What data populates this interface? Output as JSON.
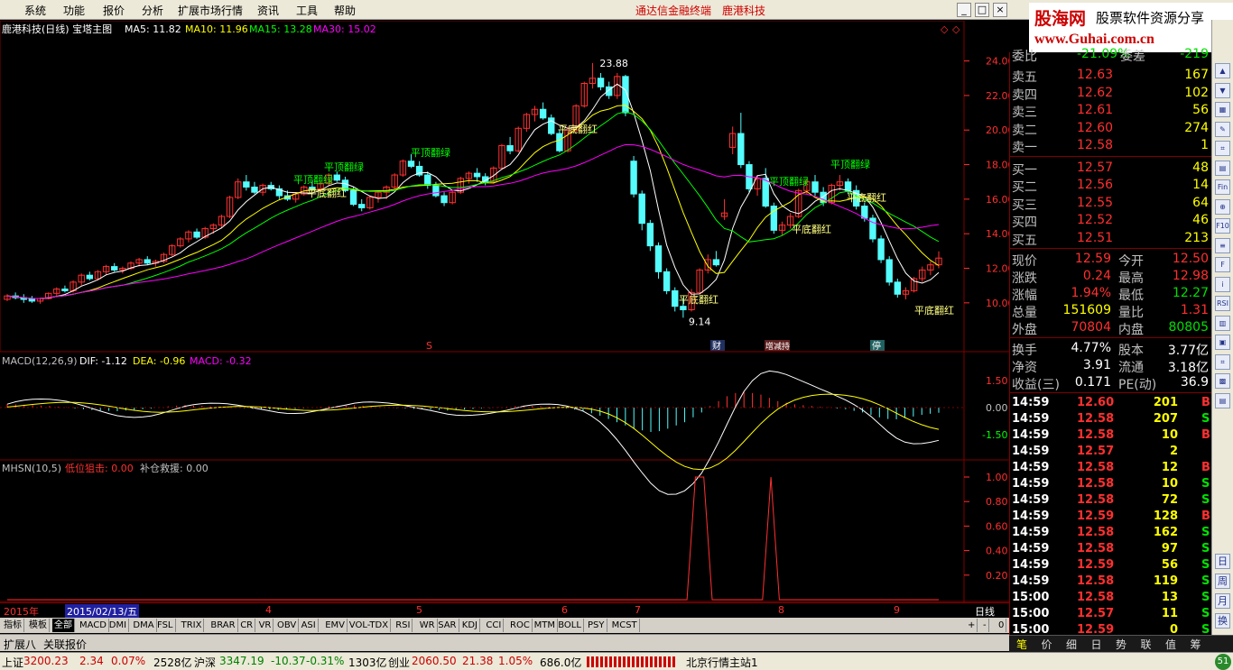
{
  "menu": {
    "items": [
      "系统",
      "功能",
      "报价",
      "分析",
      "扩展市场行情",
      "资讯",
      "工具",
      "帮助"
    ],
    "window_title": "通达信金融终端",
    "stock_title": "鹿港科技",
    "win_buttons": [
      "_",
      "□",
      "×"
    ]
  },
  "logo": {
    "cn": "股海网",
    "sub": "股票软件资源分享",
    "url": "www.Guhai.com.cn"
  },
  "main_chart": {
    "title": "鹿港科技(日线) 宝塔主图",
    "ma": [
      {
        "label": "MA5: 11.82",
        "color": "#ffffff"
      },
      {
        "label": "MA10: 11.96",
        "color": "#ffff00"
      },
      {
        "label": "MA15: 13.28",
        "color": "#00ff00"
      },
      {
        "label": "MA30: 15.02",
        "color": "#ff00ff"
      }
    ],
    "y_ticks": [
      "24.00",
      "22.00",
      "20.00",
      "18.00",
      "16.00",
      "14.00",
      "12.00",
      "10.00"
    ],
    "high_label": "23.88",
    "low_label": "9.14",
    "annotations": [
      "平顶翻绿",
      "平顶翻绿",
      "平底翻红",
      "平顶翻绿",
      "平底翻红",
      "平底翻红",
      "平顶翻绿",
      "平底翻红",
      "平顶翻绿",
      "平底翻红",
      "平底翻红"
    ],
    "markers": [
      "S",
      "财",
      "增减持",
      "停"
    ]
  },
  "macd": {
    "title": "MACD(12,26,9)",
    "dif": "DIF: -1.12",
    "dea": "DEA: -0.96",
    "macd": "MACD: -0.32",
    "y_ticks": [
      "1.50",
      "0.00",
      "-1.50"
    ]
  },
  "mhsn": {
    "title": "MHSN(10,5)",
    "low": "低位狙击: 0.00",
    "fill": "补仓救援: 0.00",
    "y_ticks": [
      "1.00",
      "0.80",
      "0.60",
      "0.40",
      "0.20"
    ]
  },
  "dates": {
    "year": "2015年",
    "cursor": "2015/02/13/五",
    "months": [
      "4",
      "5",
      "6",
      "7",
      "8",
      "9"
    ],
    "period": "日线"
  },
  "tabs": [
    "指标",
    "模板",
    "全部",
    "MACD",
    "DMI",
    "DMA",
    "FSL",
    "TRIX",
    "BRAR",
    "CR",
    "VR",
    "OBV",
    "ASI",
    "EMV",
    "VOL-TDX",
    "RSI",
    "WR",
    "SAR",
    "KDJ",
    "CCI",
    "ROC",
    "MTM",
    "BOLL",
    "PSY",
    "MCST"
  ],
  "tab_ctrl": [
    "+",
    "-",
    "0"
  ],
  "expand": [
    "扩展八",
    "关联报价"
  ],
  "quote": {
    "header": {
      "l": "委比",
      "v": "-21.09%",
      "l2": "委差",
      "v2": "-219"
    },
    "sell": [
      {
        "l": "卖五",
        "p": "12.63",
        "v": "167"
      },
      {
        "l": "卖四",
        "p": "12.62",
        "v": "102"
      },
      {
        "l": "卖三",
        "p": "12.61",
        "v": "56"
      },
      {
        "l": "卖二",
        "p": "12.60",
        "v": "274"
      },
      {
        "l": "卖一",
        "p": "12.58",
        "v": "1"
      }
    ],
    "buy": [
      {
        "l": "买一",
        "p": "12.57",
        "v": "48"
      },
      {
        "l": "买二",
        "p": "12.56",
        "v": "14"
      },
      {
        "l": "买三",
        "p": "12.55",
        "v": "64"
      },
      {
        "l": "买四",
        "p": "12.52",
        "v": "46"
      },
      {
        "l": "买五",
        "p": "12.51",
        "v": "213"
      }
    ],
    "stats": [
      {
        "a": "现价",
        "b": "12.59",
        "bc": "#ff3030",
        "c": "今开",
        "d": "12.50",
        "dc": "#ff3030"
      },
      {
        "a": "涨跌",
        "b": "0.24",
        "bc": "#ff3030",
        "c": "最高",
        "d": "12.98",
        "dc": "#ff3030"
      },
      {
        "a": "涨幅",
        "b": "1.94%",
        "bc": "#ff3030",
        "c": "最低",
        "d": "12.27",
        "dc": "#00e000"
      },
      {
        "a": "总量",
        "b": "151609",
        "bc": "#ffff00",
        "c": "量比",
        "d": "1.31",
        "dc": "#ff3030"
      },
      {
        "a": "外盘",
        "b": "70804",
        "bc": "#ff3030",
        "c": "内盘",
        "d": "80805",
        "dc": "#00e000"
      }
    ],
    "fund": [
      {
        "a": "换手",
        "b": "4.77%",
        "c": "股本",
        "d": "3.77亿"
      },
      {
        "a": "净资",
        "b": "3.91",
        "c": "流通",
        "d": "3.18亿"
      },
      {
        "a": "收益(三)",
        "b": "0.171",
        "c": "PE(动)",
        "d": "36.9"
      }
    ],
    "ticks": [
      {
        "t": "14:59",
        "p": "12.60",
        "v": "201",
        "s": "B"
      },
      {
        "t": "14:59",
        "p": "12.58",
        "v": "207",
        "s": "S"
      },
      {
        "t": "14:59",
        "p": "12.58",
        "v": "10",
        "s": "B"
      },
      {
        "t": "14:59",
        "p": "12.57",
        "v": "2",
        "s": ""
      },
      {
        "t": "14:59",
        "p": "12.58",
        "v": "12",
        "s": "B"
      },
      {
        "t": "14:59",
        "p": "12.58",
        "v": "10",
        "s": "S"
      },
      {
        "t": "14:59",
        "p": "12.58",
        "v": "72",
        "s": "S"
      },
      {
        "t": "14:59",
        "p": "12.59",
        "v": "128",
        "s": "B"
      },
      {
        "t": "14:59",
        "p": "12.58",
        "v": "162",
        "s": "S"
      },
      {
        "t": "14:59",
        "p": "12.58",
        "v": "97",
        "s": "S"
      },
      {
        "t": "14:59",
        "p": "12.59",
        "v": "56",
        "s": "S"
      },
      {
        "t": "14:59",
        "p": "12.58",
        "v": "119",
        "s": "S"
      },
      {
        "t": "15:00",
        "p": "12.58",
        "v": "13",
        "s": "S"
      },
      {
        "t": "15:00",
        "p": "12.57",
        "v": "11",
        "s": "S"
      },
      {
        "t": "15:00",
        "p": "12.59",
        "v": "0",
        "s": "S"
      }
    ],
    "tabs": [
      "笔",
      "价",
      "细",
      "日",
      "势",
      "联",
      "值",
      "筹"
    ]
  },
  "rbar_icons": [
    "arrow-up-icon",
    "arrow-down-icon",
    "grid-icon",
    "pen-icon",
    "chart-icon",
    "list-icon",
    "fin-icon",
    "zoom-icon",
    "f10-icon",
    "news-icon",
    "f-icon",
    "i-icon",
    "rsi-icon",
    "bar-icon",
    "report-icon",
    "chart2-icon",
    "macd-icon",
    "note-icon"
  ],
  "rbar_labels": [
    "▲",
    "▼",
    "▦",
    "✎",
    "⌗",
    "▤",
    "Fin",
    "⊕",
    "F10",
    "≡",
    "F",
    "i",
    "RSI",
    "▥",
    "▣",
    "⌗",
    "▩",
    "▤"
  ],
  "rbar_side": [
    "日",
    "周",
    "月",
    "换"
  ],
  "status": {
    "sh_label": "上证",
    "sh_val": "3200.23",
    "sh_chg": "2.34",
    "sh_pct": "0.07%",
    "sh_amt": "2528亿",
    "sz_label": "沪深",
    "sz_val": "3347.19",
    "sz_chg": "-10.37",
    "sz_pct": "-0.31%",
    "sz_amt": "1303亿",
    "cy_label": "创业",
    "cy_val": "2060.50",
    "cy_chg": "21.38",
    "cy_pct": "1.05%",
    "cy_amt": "686.0亿",
    "server": "北京行情主站1",
    "badge": "51"
  },
  "colors": {
    "up": "#ff3030",
    "down": "#54fcfc",
    "panel_border": "#800000",
    "ma5": "#ffffff",
    "ma10": "#ffff00",
    "ma15": "#00ff00",
    "ma30": "#ff00ff"
  },
  "chart_data": {
    "type": "candlestick",
    "title": "鹿港科技(日线)",
    "y_range": [
      9.0,
      24.5
    ],
    "high": 23.88,
    "low": 9.14,
    "ohlc": [
      [
        10.2,
        10.5,
        10.1,
        10.4
      ],
      [
        10.4,
        10.6,
        10.2,
        10.3
      ],
      [
        10.3,
        10.5,
        10.0,
        10.2
      ],
      [
        10.2,
        10.4,
        10.0,
        10.1
      ],
      [
        10.1,
        10.3,
        9.95,
        10.25
      ],
      [
        10.25,
        10.6,
        10.2,
        10.55
      ],
      [
        10.55,
        10.9,
        10.4,
        10.8
      ],
      [
        10.8,
        11.0,
        10.6,
        10.7
      ],
      [
        10.7,
        11.3,
        10.6,
        11.2
      ],
      [
        11.2,
        11.7,
        11.0,
        11.6
      ],
      [
        11.6,
        11.8,
        11.3,
        11.4
      ],
      [
        11.4,
        11.9,
        11.3,
        11.8
      ],
      [
        11.8,
        12.2,
        11.6,
        12.1
      ],
      [
        12.1,
        12.3,
        11.8,
        11.9
      ],
      [
        11.9,
        12.1,
        11.7,
        12.0
      ],
      [
        12.0,
        12.4,
        11.9,
        12.3
      ],
      [
        12.3,
        12.6,
        12.1,
        12.5
      ],
      [
        12.5,
        12.7,
        12.2,
        12.3
      ],
      [
        12.3,
        12.5,
        12.1,
        12.4
      ],
      [
        12.4,
        12.9,
        12.3,
        12.8
      ],
      [
        12.8,
        13.4,
        12.7,
        13.3
      ],
      [
        13.3,
        13.8,
        13.2,
        13.7
      ],
      [
        13.7,
        14.2,
        13.5,
        14.1
      ],
      [
        14.1,
        14.3,
        13.7,
        13.8
      ],
      [
        13.8,
        14.4,
        13.7,
        14.3
      ],
      [
        14.3,
        14.6,
        14.0,
        14.5
      ],
      [
        14.5,
        15.1,
        14.3,
        15.0
      ],
      [
        15.0,
        16.2,
        14.9,
        16.1
      ],
      [
        16.1,
        17.2,
        16.0,
        17.0
      ],
      [
        17.0,
        17.4,
        16.5,
        16.7
      ],
      [
        16.7,
        17.0,
        16.3,
        16.4
      ],
      [
        16.4,
        16.9,
        16.2,
        16.8
      ],
      [
        16.8,
        17.0,
        16.5,
        16.6
      ],
      [
        16.6,
        16.8,
        16.0,
        16.2
      ],
      [
        16.2,
        16.5,
        15.9,
        16.0
      ],
      [
        16.0,
        16.4,
        15.8,
        16.3
      ],
      [
        16.3,
        16.8,
        16.2,
        16.7
      ],
      [
        16.7,
        17.1,
        16.5,
        16.6
      ],
      [
        16.6,
        17.0,
        16.4,
        16.9
      ],
      [
        16.9,
        17.5,
        16.8,
        17.4
      ],
      [
        17.4,
        17.6,
        17.0,
        17.1
      ],
      [
        17.1,
        17.3,
        16.4,
        16.5
      ],
      [
        16.5,
        16.7,
        15.6,
        15.7
      ],
      [
        15.7,
        16.0,
        15.3,
        15.5
      ],
      [
        15.5,
        16.2,
        15.4,
        16.1
      ],
      [
        16.1,
        16.5,
        15.8,
        16.4
      ],
      [
        16.4,
        16.8,
        16.0,
        16.7
      ],
      [
        16.7,
        17.5,
        16.6,
        17.4
      ],
      [
        17.4,
        18.3,
        17.3,
        18.2
      ],
      [
        18.2,
        18.6,
        17.8,
        17.9
      ],
      [
        17.9,
        18.2,
        17.3,
        17.4
      ],
      [
        17.4,
        17.6,
        16.6,
        16.8
      ],
      [
        16.8,
        17.0,
        16.1,
        16.2
      ],
      [
        16.2,
        16.4,
        15.6,
        15.8
      ],
      [
        15.8,
        16.5,
        15.7,
        16.4
      ],
      [
        16.4,
        17.3,
        16.3,
        17.2
      ],
      [
        17.2,
        17.6,
        16.9,
        17.5
      ],
      [
        17.5,
        17.8,
        17.0,
        17.3
      ],
      [
        17.3,
        17.5,
        16.8,
        17.0
      ],
      [
        17.0,
        17.9,
        16.9,
        17.8
      ],
      [
        17.8,
        19.2,
        17.7,
        19.1
      ],
      [
        19.1,
        19.6,
        18.6,
        18.8
      ],
      [
        18.8,
        20.2,
        18.7,
        20.1
      ],
      [
        20.1,
        21.0,
        19.9,
        20.9
      ],
      [
        20.9,
        21.4,
        20.5,
        21.2
      ],
      [
        21.2,
        21.6,
        20.6,
        20.7
      ],
      [
        20.7,
        20.9,
        19.7,
        19.8
      ],
      [
        19.8,
        20.0,
        18.7,
        18.8
      ],
      [
        18.8,
        20.2,
        18.7,
        20.0
      ],
      [
        20.0,
        21.5,
        19.9,
        21.4
      ],
      [
        21.4,
        22.8,
        21.3,
        22.7
      ],
      [
        22.7,
        23.88,
        22.4,
        23.0
      ],
      [
        23.0,
        23.3,
        22.3,
        22.5
      ],
      [
        22.5,
        22.8,
        21.8,
        22.0
      ],
      [
        22.0,
        23.3,
        21.8,
        23.1
      ],
      [
        23.1,
        23.2,
        20.8,
        21.0
      ],
      [
        18.2,
        18.5,
        16.1,
        16.3
      ],
      [
        16.3,
        16.5,
        14.2,
        14.6
      ],
      [
        14.6,
        14.8,
        13.0,
        13.3
      ],
      [
        13.3,
        13.5,
        11.4,
        11.8
      ],
      [
        11.8,
        12.0,
        10.5,
        10.7
      ],
      [
        10.7,
        10.9,
        9.5,
        9.8
      ],
      [
        9.8,
        10.3,
        9.14,
        9.6
      ],
      [
        9.6,
        10.8,
        9.5,
        10.6
      ],
      [
        10.6,
        12.0,
        10.5,
        11.9
      ],
      [
        11.9,
        12.8,
        11.7,
        12.5
      ],
      [
        12.5,
        13.0,
        12.1,
        12.2
      ],
      [
        15.0,
        16.0,
        14.8,
        15.2
      ],
      [
        19.0,
        20.2,
        18.6,
        19.8
      ],
      [
        19.8,
        21.0,
        17.8,
        18.0
      ],
      [
        18.0,
        18.2,
        16.4,
        16.6
      ],
      [
        16.6,
        17.4,
        16.2,
        17.2
      ],
      [
        17.2,
        17.8,
        15.5,
        15.6
      ],
      [
        15.6,
        15.8,
        14.0,
        14.2
      ],
      [
        14.2,
        14.7,
        13.9,
        14.5
      ],
      [
        14.5,
        15.2,
        14.3,
        15.0
      ],
      [
        15.0,
        16.6,
        14.9,
        16.5
      ],
      [
        16.5,
        17.2,
        16.3,
        17.0
      ],
      [
        17.0,
        17.4,
        16.2,
        16.4
      ],
      [
        16.4,
        16.7,
        15.6,
        15.8
      ],
      [
        15.8,
        16.9,
        15.7,
        16.8
      ],
      [
        16.8,
        17.4,
        16.5,
        17.0
      ],
      [
        17.0,
        17.2,
        16.3,
        16.5
      ],
      [
        16.5,
        16.8,
        15.4,
        15.6
      ],
      [
        15.6,
        15.8,
        14.7,
        14.9
      ],
      [
        14.9,
        15.1,
        13.5,
        13.7
      ],
      [
        13.7,
        13.9,
        12.3,
        12.5
      ],
      [
        12.5,
        12.7,
        11.0,
        11.2
      ],
      [
        11.2,
        11.4,
        10.3,
        10.5
      ],
      [
        10.5,
        10.9,
        10.2,
        10.7
      ],
      [
        10.7,
        11.5,
        10.6,
        11.4
      ],
      [
        11.4,
        12.1,
        11.2,
        11.9
      ],
      [
        11.9,
        12.4,
        11.6,
        12.2
      ],
      [
        12.2,
        12.98,
        12.0,
        12.59
      ]
    ],
    "macd_histogram": [
      0.22,
      0.2,
      0.18,
      0.15,
      0.12,
      0.1,
      0.05,
      0.02,
      -0.05,
      -0.1,
      -0.15,
      -0.18,
      -0.2,
      -0.22,
      -0.18,
      -0.15,
      -0.1,
      -0.05,
      0.02,
      0.08,
      0.12,
      0.15,
      0.12,
      0.1,
      0.08,
      0.05,
      0.02,
      -0.02,
      -0.05,
      -0.08,
      -0.1,
      -0.12,
      -0.15,
      -0.12,
      -0.08,
      -0.05,
      0.02,
      0.05,
      0.08,
      0.1,
      0.12,
      0.15,
      0.12,
      0.08,
      0.05,
      0.02,
      -0.02,
      -0.05,
      -0.08,
      -0.1,
      -0.12,
      -0.15,
      -0.18,
      -0.15,
      -0.12,
      -0.08,
      -0.05,
      -0.02,
      0.02,
      0.05,
      0.1,
      0.12,
      0.1,
      0.08,
      0.05,
      0.02,
      -0.05,
      -0.12,
      -0.2,
      -0.35,
      -0.5,
      -0.7,
      -0.9,
      -1.1,
      -1.3,
      -1.4,
      -1.5,
      -1.45,
      -1.3,
      -1.1,
      -0.9,
      -0.6,
      -0.3,
      0.1,
      0.4,
      0.7,
      0.9,
      1.0,
      0.9,
      0.8,
      0.6,
      0.4,
      0.3,
      0.2,
      0.15,
      0.1,
      0.05,
      0.02,
      -0.05,
      -0.1,
      -0.2,
      -0.3,
      -0.45,
      -0.6,
      -0.7,
      -0.72,
      -0.65,
      -0.55,
      -0.45,
      -0.38,
      -0.32
    ],
    "mhsn_low": [
      0,
      0,
      0,
      0,
      0,
      0,
      0,
      0,
      0,
      0,
      0,
      0,
      0,
      0,
      0,
      0,
      0,
      0,
      0,
      0,
      0,
      0,
      0,
      0,
      0,
      0,
      0,
      0,
      0,
      0,
      0,
      0,
      0,
      0,
      0,
      0,
      0,
      0,
      0,
      0,
      0,
      0,
      0,
      0,
      0,
      0,
      0,
      0,
      0,
      0,
      0,
      0,
      0,
      0,
      0,
      0,
      0,
      0,
      0,
      0,
      0,
      0,
      0,
      0,
      0,
      0,
      0,
      0,
      0,
      0,
      0,
      0,
      0,
      0,
      0,
      0,
      0,
      0,
      0,
      0,
      0,
      0,
      1,
      1,
      0,
      0,
      0,
      0,
      0,
      0,
      0,
      1,
      0,
      0,
      0,
      0,
      0,
      0,
      0,
      0,
      0,
      0,
      0,
      0,
      0,
      0,
      0,
      0,
      0,
      0,
      0,
      0
    ]
  }
}
